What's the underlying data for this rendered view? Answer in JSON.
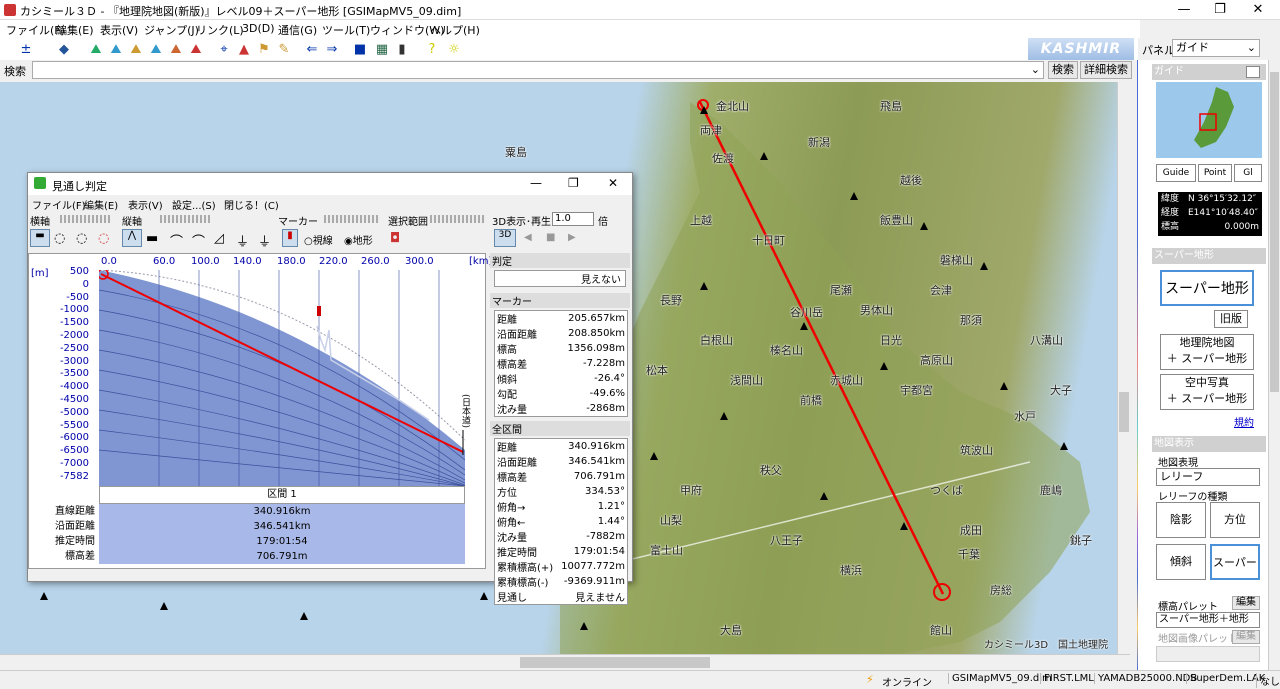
{
  "window": {
    "title": "カシミール３Ｄ - 『地理院地図(新版)』レベル09＋スーパー地形 [GSIMapMV5_09.dim]",
    "min": "—",
    "max": "❐",
    "close": "✕"
  },
  "menu": [
    "ファイル(F)",
    "編集(E)",
    "表示(V)",
    "ジャンプ(J)",
    "リンク(L)",
    "3D(D)",
    "通信(G)",
    "ツール(T)",
    "ウィンドウ(W)",
    "ヘルプ(H)"
  ],
  "brand": "KASHMIR 3D",
  "panel": {
    "label": "パネル",
    "value": "ガイド"
  },
  "search": {
    "label": "検索",
    "btn": "検索",
    "detail_btn": "詳細検索"
  },
  "map_labels": [
    "金北山",
    "両津",
    "佐渡",
    "新潟",
    "越後",
    "粟島",
    "飛島",
    "十日町",
    "上越",
    "長野",
    "水戸",
    "千葉",
    "松本",
    "前橋",
    "宇都宮",
    "日光",
    "秩父",
    "甲府",
    "谷川岳",
    "浅間山",
    "赤城山",
    "筑波山",
    "飯豊山",
    "磐梯山",
    "会津",
    "尾瀬",
    "男体山",
    "八溝山",
    "榛名山",
    "白根山",
    "大子",
    "那須",
    "高原山",
    "横浜",
    "房総",
    "館山",
    "大島",
    "富士山",
    "山梨",
    "八王子",
    "つくば",
    "鹿嶋",
    "成田",
    "銚子"
  ],
  "map_credit": "カシミール3D　国土地理院",
  "dialog": {
    "title": "見通し判定",
    "menu": [
      "ファイル(F)",
      "編集(E)",
      "表示(V)",
      "設定...(S)",
      "閉じる！(C)"
    ],
    "toolbar_labels": {
      "yoko": "横軸",
      "tate": "縦軸",
      "marker": "マーカー",
      "select": "選択範囲",
      "view3d": "3D表示･再生",
      "speed": "1.0",
      "bai": "倍"
    },
    "radio": {
      "line": "視線",
      "terrain": "地形"
    },
    "y_unit": "[m]",
    "x_unit": "[km]",
    "y_ticks": [
      "500",
      "0",
      "-500",
      "-1000",
      "-1500",
      "-2000",
      "-2500",
      "-3000",
      "-3500",
      "-4000",
      "-4500",
      "-5000",
      "-5500",
      "-6000",
      "-6500",
      "-7000",
      "-7582"
    ],
    "x_ticks": [
      "0.0",
      "60.0",
      "100.0",
      "140.0",
      "180.0",
      "220.0",
      "260.0",
      "300.0"
    ],
    "end_label": "(日本道)",
    "section": {
      "title": "区間 1",
      "rows": [
        {
          "k": "直線距離",
          "v": "340.916km"
        },
        {
          "k": "沿面距離",
          "v": "346.541km"
        },
        {
          "k": "推定時間",
          "v": "179:01:54"
        },
        {
          "k": "標高差",
          "v": "706.791m"
        }
      ]
    },
    "judge": {
      "title": "判定",
      "value": "見えない"
    },
    "marker": {
      "title": "マーカー",
      "rows": [
        [
          "距離",
          "205.657km"
        ],
        [
          "沿面距離",
          "208.850km"
        ],
        [
          "標高",
          "1356.098m"
        ],
        [
          "標高差",
          "-7.228m"
        ],
        [
          "傾斜",
          "-26.4°"
        ],
        [
          "勾配",
          "-49.6%"
        ],
        [
          "沈み量",
          "-2868m"
        ]
      ]
    },
    "whole": {
      "title": "全区間",
      "rows": [
        [
          "距離",
          "340.916km"
        ],
        [
          "沿面距離",
          "346.541km"
        ],
        [
          "標高差",
          "706.791m"
        ],
        [
          "方位",
          "334.53°"
        ],
        [
          "俯角→",
          "1.21°"
        ],
        [
          "俯角←",
          "1.44°"
        ],
        [
          "沈み量",
          "-7882m"
        ],
        [
          "推定時間",
          "179:01:54"
        ],
        [
          "累積標高(+)",
          "10077.772m"
        ],
        [
          "累積標高(-)",
          "-9369.911m"
        ],
        [
          "見通し",
          "見えません"
        ]
      ]
    }
  },
  "right_panel": {
    "guide": {
      "title": "ガイド",
      "tabs": [
        "Guide",
        "Point",
        "Gl"
      ],
      "lat": "緯度　N 36°15′32.12″",
      "lon": "経度　E141°10′48.40″",
      "elev_k": "標高",
      "elev_v": "0.000m"
    },
    "super": {
      "title": "スーパー地形",
      "main": "スーパー地形",
      "old": "旧版",
      "gsi": "地理院地図\n＋ スーパー地形",
      "photo": "空中写真\n＋ スーパー地形",
      "terms": "規約"
    },
    "mapview": {
      "title": "地図表示",
      "expr": "地図表現",
      "select": "レリーフ",
      "kind": "レリーフの種類",
      "b1": "陰影",
      "b2": "方位",
      "b3": "傾斜",
      "b4": "スーパー",
      "palette": "標高パレット",
      "edit": "編集",
      "palette_val": "スーパー地形＋地形",
      "img_palette": "地図画像パレット",
      "edit2": "編集"
    }
  },
  "status": {
    "online": "オンライン",
    "items": [
      "GSIMapMV5_09.dim",
      "FIRST.LML",
      "YAMADB25000.NDB",
      "SuperDem.LAK",
      "なし"
    ]
  }
}
